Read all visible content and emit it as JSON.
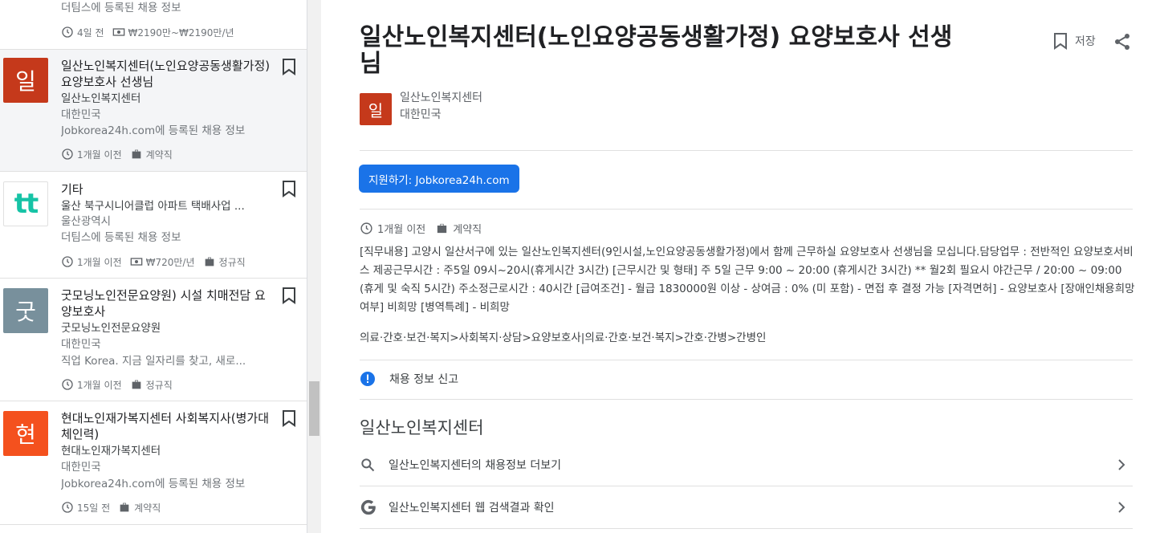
{
  "list": {
    "cards": [
      {
        "source": "더팀스에 등록된 채용 정보",
        "time": "4일 전",
        "salary": "₩2190만~₩2190만/년"
      },
      {
        "logo_text": "일",
        "logo_color": "#c5391b",
        "title": "일산노인복지센터(노인요양공동생활가정) 요양보호사 선생님",
        "company": "일산노인복지센터",
        "location": "대한민국",
        "source": "Jobkorea24h.com에 등록된 채용 정보",
        "time": "1개월 이전",
        "type": "계약직"
      },
      {
        "logo_text": "tt",
        "title": "기타",
        "company": "울산 북구시니어클럽 아파트 택배사업 ...",
        "location": "울산광역시",
        "source": "더팀스에 등록된 채용 정보",
        "time": "1개월 이전",
        "salary": "₩720만/년",
        "type": "정규직"
      },
      {
        "logo_text": "굿",
        "logo_color": "#78909c",
        "title": "굿모닝노인전문요양원) 시설 치매전담 요양보호사",
        "company": "굿모닝노인전문요양원",
        "location": "대한민국",
        "source": "직업 Korea. 지금 일자리를 찾고, 새로...",
        "time": "1개월 이전",
        "type": "정규직"
      },
      {
        "logo_text": "현",
        "logo_color": "#f4511e",
        "title": "현대노인재가복지센터 사회복지사(병가대체인력)",
        "company": "현대노인재가복지센터",
        "location": "대한민국",
        "source": "Jobkorea24h.com에 등록된 채용 정보",
        "time": "15일 전",
        "type": "계약직"
      }
    ]
  },
  "detail": {
    "title": "일산노인복지센터(노인요양공동생활가정) 요양보호사 선생님",
    "save_label": "저장",
    "company_logo_text": "일",
    "company_name": "일산노인복지센터",
    "company_location": "대한민국",
    "apply_label": "지원하기: Jobkorea24h.com",
    "time": "1개월 이전",
    "type": "계약직",
    "description": "[직무내용] 고양시 일산서구에 있는 일산노인복지센터(9인시설,노인요양공동생활가정)에서 함께 근무하실 요양보호사 선생님을 모십니다.담당업무 : 전반적인 요양보호서비스 제공근무시간 : 주5일 09시~20시(휴게시간 3시간) [근무시간 및 형태] 주 5일 근무 9:00 ~ 20:00 (휴게시간 3시간) ** 월2회 필요시 야간근무 / 20:00 ~ 09:00 (휴게 및 숙직 5시간) 주소정근로시간 : 40시간 [급여조건] - 월급 1830000원 이상 - 상여금 : 0% (미 포함) - 면접 후 결정 가능 [자격면허] - 요양보호사 [장애인채용희망여부] 비희망 [병역특례] - 비희망",
    "category": "의료·간호·보건·복지>사회복지·상담>요양보호사|의료·간호·보건·복지>간호·간병>간병인",
    "report_label": "채용 정보 신고",
    "section_title": "일산노인복지센터",
    "more_jobs_label": "일산노인복지센터의 채용정보 더보기",
    "web_search_label": "일산노인복지센터 웹 검색결과 확인"
  },
  "colors": {
    "apply_button": "#1a73e8",
    "report_icon": "#1a73e8"
  }
}
